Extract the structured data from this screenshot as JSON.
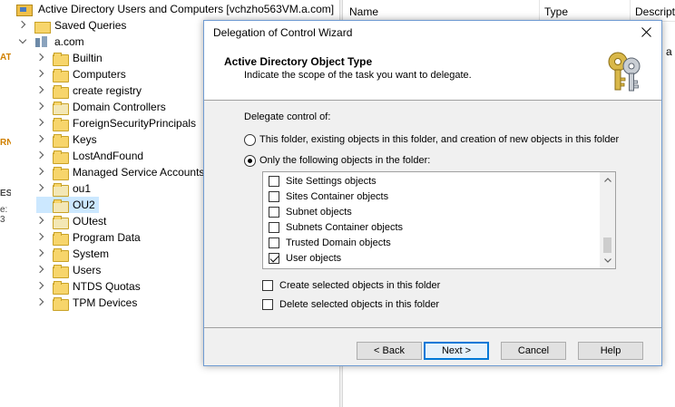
{
  "console": {
    "edge_fragments": [
      "AT",
      "RN",
      "ES",
      "e: 3"
    ],
    "tree_root": "Active Directory Users and Computers [vchzho563VM.a.com]",
    "tree": [
      {
        "label": "Saved Queries",
        "expander": "right",
        "icon": "saved-queries-icon",
        "indent": 0
      },
      {
        "label": "a.com",
        "expander": "down",
        "icon": "domain-icon",
        "indent": 0
      },
      {
        "label": "Builtin",
        "expander": "right",
        "icon": "folder-icon",
        "indent": 1
      },
      {
        "label": "Computers",
        "expander": "right",
        "icon": "folder-icon",
        "indent": 1
      },
      {
        "label": "create registry",
        "expander": "right",
        "icon": "folder-icon",
        "indent": 1
      },
      {
        "label": "Domain Controllers",
        "expander": "right",
        "icon": "ou-icon",
        "indent": 1
      },
      {
        "label": "ForeignSecurityPrincipals",
        "expander": "right",
        "icon": "folder-icon",
        "indent": 1
      },
      {
        "label": "Keys",
        "expander": "right",
        "icon": "folder-icon",
        "indent": 1
      },
      {
        "label": "LostAndFound",
        "expander": "right",
        "icon": "folder-icon",
        "indent": 1
      },
      {
        "label": "Managed Service Accounts",
        "expander": "right",
        "icon": "folder-icon",
        "indent": 1
      },
      {
        "label": "ou1",
        "expander": "right",
        "icon": "ou-icon",
        "indent": 1
      },
      {
        "label": "OU2",
        "expander": "none",
        "icon": "ou-icon",
        "indent": 1,
        "selected": true
      },
      {
        "label": "OUtest",
        "expander": "right",
        "icon": "ou-icon",
        "indent": 1
      },
      {
        "label": "Program Data",
        "expander": "right",
        "icon": "folder-icon",
        "indent": 1
      },
      {
        "label": "System",
        "expander": "right",
        "icon": "folder-icon",
        "indent": 1
      },
      {
        "label": "Users",
        "expander": "right",
        "icon": "folder-icon",
        "indent": 1
      },
      {
        "label": "NTDS Quotas",
        "expander": "right",
        "icon": "folder-icon",
        "indent": 1
      },
      {
        "label": "TPM Devices",
        "expander": "right",
        "icon": "folder-icon",
        "indent": 1
      }
    ],
    "list_columns": [
      "Name",
      "Type",
      "Descript"
    ],
    "list_cell_fragment": "t-in a"
  },
  "wizard": {
    "title": "Delegation of Control Wizard",
    "header_title": "Active Directory Object Type",
    "header_subtitle": "Indicate the scope of the task you want to delegate.",
    "delegate_label": "Delegate control of:",
    "radio_all": "This folder, existing objects in this folder, and creation of new objects in this folder",
    "radio_only": "Only the following objects in the folder:",
    "selected_radio": "only",
    "objects": [
      {
        "label": "Site Settings objects",
        "checked": false
      },
      {
        "label": "Sites Container objects",
        "checked": false
      },
      {
        "label": "Subnet objects",
        "checked": false
      },
      {
        "label": "Subnets Container objects",
        "checked": false
      },
      {
        "label": "Trusted Domain objects",
        "checked": false
      },
      {
        "label": "User objects",
        "checked": true
      }
    ],
    "create_selected": "Create selected objects in this folder",
    "delete_selected": "Delete selected objects in this folder",
    "create_checked": false,
    "delete_checked": false,
    "buttons": {
      "back": "< Back",
      "next": "Next >",
      "cancel": "Cancel",
      "help": "Help"
    }
  }
}
